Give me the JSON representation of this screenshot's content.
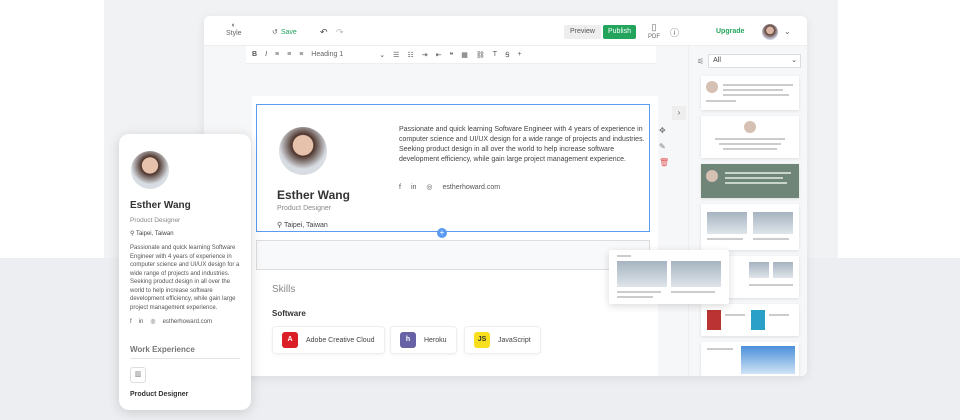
{
  "toolbar": {
    "style_label": "Style",
    "save_label": "Save",
    "preview_label": "Preview",
    "publish_label": "Publish",
    "pdf_label": "PDF",
    "upgrade_label": "Upgrade"
  },
  "format": {
    "heading": "Heading 1"
  },
  "profile": {
    "name": "Esther Wang",
    "role": "Product Designer",
    "location": "Taipei, Taiwan",
    "bio": "Passionate and quick learning Software Engineer with 4 years of experience in computer science and UI/UX design for a wide range of projects and industries. Seeking product design in all over the world to help increase software development efficiency, while gain large project management experience.",
    "website": "estherhoward.com"
  },
  "skills": {
    "heading": "Skills",
    "software_heading": "Software",
    "items": [
      {
        "label": "Adobe Creative Cloud",
        "color": "#da1f26"
      },
      {
        "label": "Heroku",
        "color": "#6762a6"
      },
      {
        "label": "JavaScript",
        "color": "#f7df1e"
      }
    ]
  },
  "templates": {
    "filter_value": "All"
  },
  "mobile": {
    "work_heading": "Work Experience",
    "job_title": "Product Designer"
  },
  "colors": {
    "accent": "#22a45d",
    "selection": "#5b9cf3"
  }
}
